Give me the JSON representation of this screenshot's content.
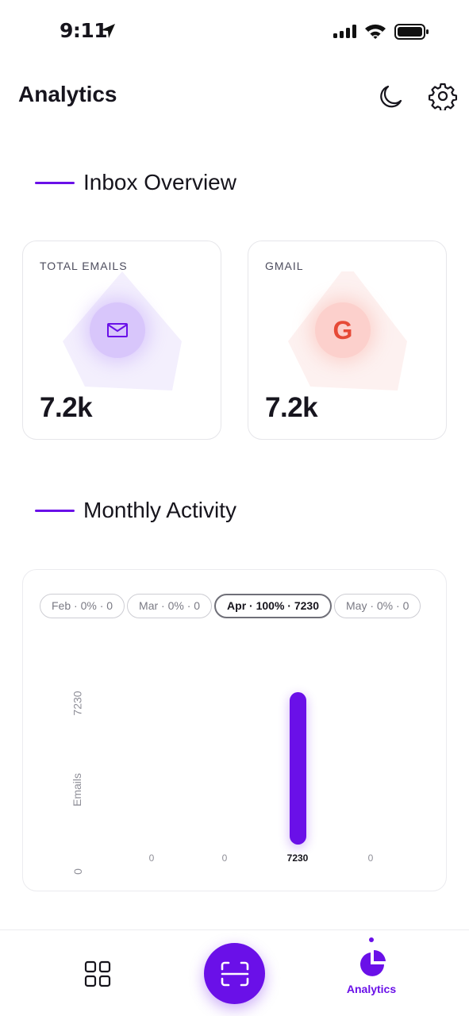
{
  "status_bar": {
    "time": "9:11",
    "icons": [
      "location-arrow-icon",
      "cellular-signal-icon",
      "wifi-icon",
      "battery-icon"
    ]
  },
  "header": {
    "title": "Analytics",
    "actions": [
      "moon-icon",
      "gear-icon"
    ]
  },
  "inbox_overview": {
    "heading": "Inbox Overview",
    "cards": [
      {
        "label": "TOTAL EMAILS",
        "value": "7.2k",
        "icon": "mail-icon",
        "accent": "#6a10e8"
      },
      {
        "label": "GMAIL",
        "value": "7.2k",
        "icon": "google-icon",
        "accent": "#e64a37"
      }
    ]
  },
  "monthly_activity": {
    "heading": "Monthly Activity",
    "chips": [
      {
        "label": "Feb · 0% · 0",
        "selected": false
      },
      {
        "label": "Mar · 0% · 0",
        "selected": false
      },
      {
        "label": "Apr · 100% · 7230",
        "selected": true
      },
      {
        "label": "May · 0% · 0",
        "selected": false
      }
    ]
  },
  "chart_data": {
    "type": "bar",
    "categories": [
      "Feb",
      "Mar",
      "Apr",
      "May"
    ],
    "values": [
      0,
      0,
      7230,
      0
    ],
    "value_labels": [
      "0",
      "0",
      "7230",
      "0"
    ],
    "ylabel": "Emails",
    "y_tick_labels": [
      "0",
      "7230"
    ],
    "ylim": [
      0,
      7230
    ],
    "bar_color": "#6a10e8",
    "grid": false
  },
  "bottom_nav": {
    "items": [
      {
        "icon": "grid-icon",
        "label": ""
      },
      {
        "icon": "scan-icon",
        "label": ""
      },
      {
        "icon": "pie-chart-icon",
        "label": "Analytics",
        "active": true
      }
    ]
  },
  "colors": {
    "accent": "#6a10e8",
    "text": "#16141c",
    "google_red": "#e64a37"
  }
}
